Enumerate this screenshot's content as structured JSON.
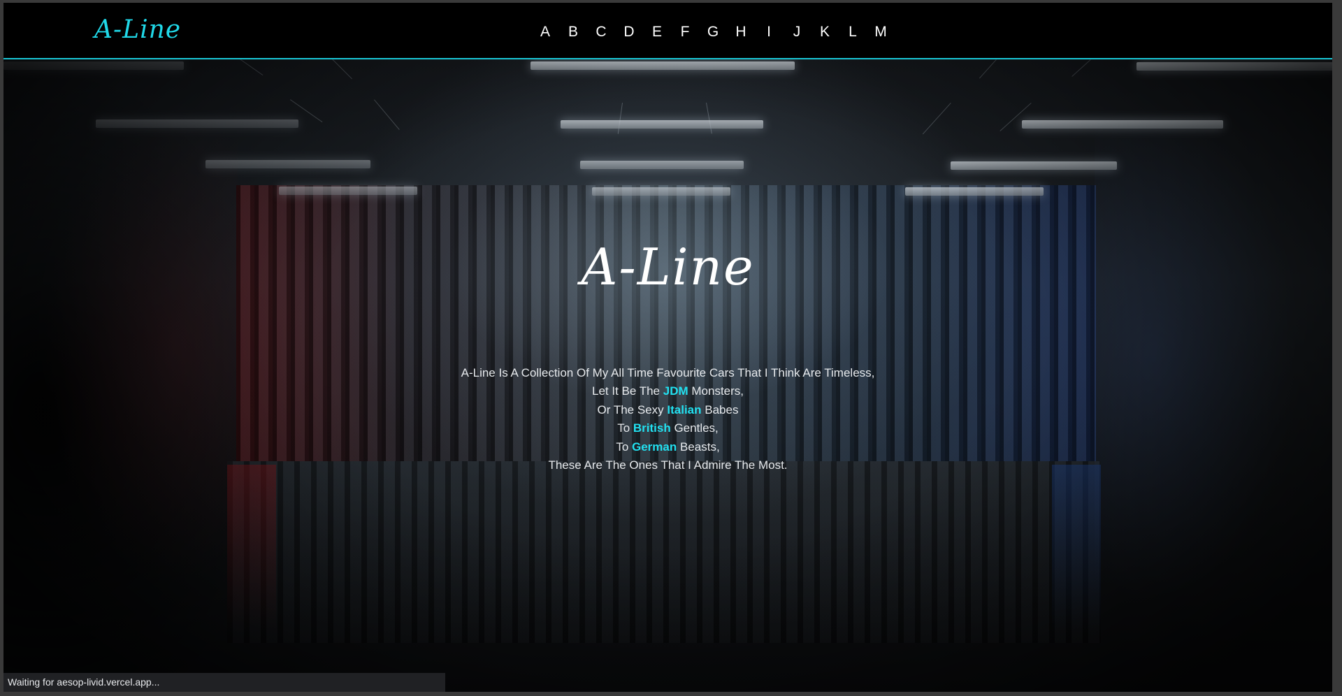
{
  "brand": {
    "logo": "A-Line"
  },
  "nav": {
    "letters": [
      "A",
      "B",
      "C",
      "D",
      "E",
      "F",
      "G",
      "H",
      "I",
      "J",
      "K",
      "L",
      "M"
    ]
  },
  "hero": {
    "title": "A-Line",
    "line1": "A-Line Is A Collection Of My All Time Favourite Cars That I Think Are Timeless,",
    "line2_pre": "Let It Be The ",
    "line2_hl": "JDM",
    "line2_post": " Monsters,",
    "line3_pre": "Or The Sexy ",
    "line3_hl": "Italian",
    "line3_post": " Babes",
    "line4_pre": "To ",
    "line4_hl": "British",
    "line4_post": " Gentles,",
    "line5_pre": "To ",
    "line5_hl": "German",
    "line5_post": " Beasts,",
    "line6": "These Are The Ones That I Admire The Most."
  },
  "status": {
    "text": "Waiting for aesop-livid.vercel.app..."
  },
  "colors": {
    "accent": "#22e0f0",
    "navbar_bg": "#000000",
    "text": "#e6e9ec"
  }
}
